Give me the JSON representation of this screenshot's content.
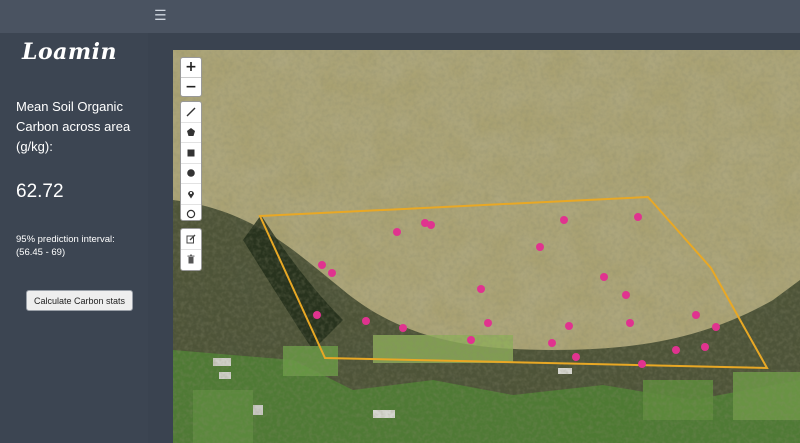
{
  "topbar": {
    "menu_icon": "☰"
  },
  "sidebar": {
    "logo": "Loamin",
    "metric_title": "Mean Soil Organic Carbon across area (g/kg):",
    "metric_value": "62.72",
    "interval_label": "95% prediction interval:",
    "interval_value": "(56.45 - 69)",
    "calc_button": "Calculate Carbon stats"
  },
  "map": {
    "zoom_in": "+",
    "zoom_out": "−",
    "draw_tools": [
      "polyline-icon",
      "polygon-icon",
      "rectangle-icon",
      "circle-icon",
      "marker-icon",
      "circlemarker-icon"
    ],
    "edit_tools": [
      "edit-icon",
      "trash-icon"
    ],
    "polygon_color": "#e8a825",
    "sample_color": "#e0338f"
  }
}
